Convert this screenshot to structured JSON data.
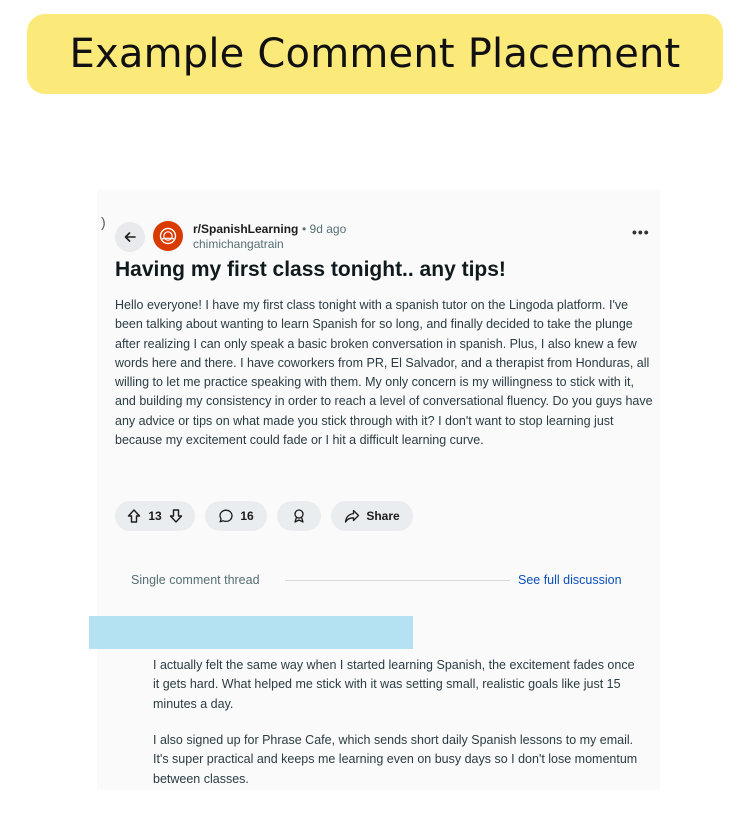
{
  "banner": {
    "title": "Example Comment Placement"
  },
  "post": {
    "stray_char": ")",
    "subreddit": "r/SpanishLearning",
    "age": "• 9d ago",
    "author": "chimichangatrain",
    "more_label": "•••",
    "title": "Having my first class tonight.. any tips!",
    "body": "Hello everyone! I have my first class tonight with a spanish tutor on the Lingoda platform. I've been talking about wanting to learn Spanish for so long, and finally decided to take the plunge after realizing I can only speak a basic broken conversation in spanish. Plus, I also knew a few words here and there. I have coworkers from PR, El Salvador, and a therapist from Honduras, all willing to let me practice speaking with them. My only concern is my willingness to stick with it, and building my consistency in order to reach a level of conversational fluency. Do you guys have any advice or tips on what made you stick through with it? I don't want to stop learning just because my excitement could fade or I hit a difficult learning curve."
  },
  "actions": {
    "vote_count": "13",
    "comment_count": "16",
    "share_label": "Share"
  },
  "thread": {
    "label": "Single comment thread",
    "see_full_label": "See full discussion"
  },
  "comment": {
    "paragraph1": "I actually felt the same way when I started learning Spanish, the excitement fades once it gets hard. What helped me stick with it was setting small, realistic goals like just 15 minutes a day.",
    "paragraph2": "I also signed up for Phrase Cafe, which sends short daily Spanish lessons to my email. It's super practical and keeps me learning even on busy days so I don't lose momentum between classes."
  },
  "colors": {
    "banner_bg": "#fbe97a",
    "avatar_bg": "#d93a00",
    "link_blue": "#0a4fb8",
    "redaction_bar": "#b4e2f3"
  },
  "icons": {
    "back": "arrow-left-icon",
    "avatar": "subreddit-avatar-icon",
    "upvote": "upvote-arrow-icon",
    "downvote": "downvote-arrow-icon",
    "comment": "speech-bubble-icon",
    "award": "award-ribbon-icon",
    "share": "share-arrow-icon",
    "more": "more-dots-icon"
  }
}
